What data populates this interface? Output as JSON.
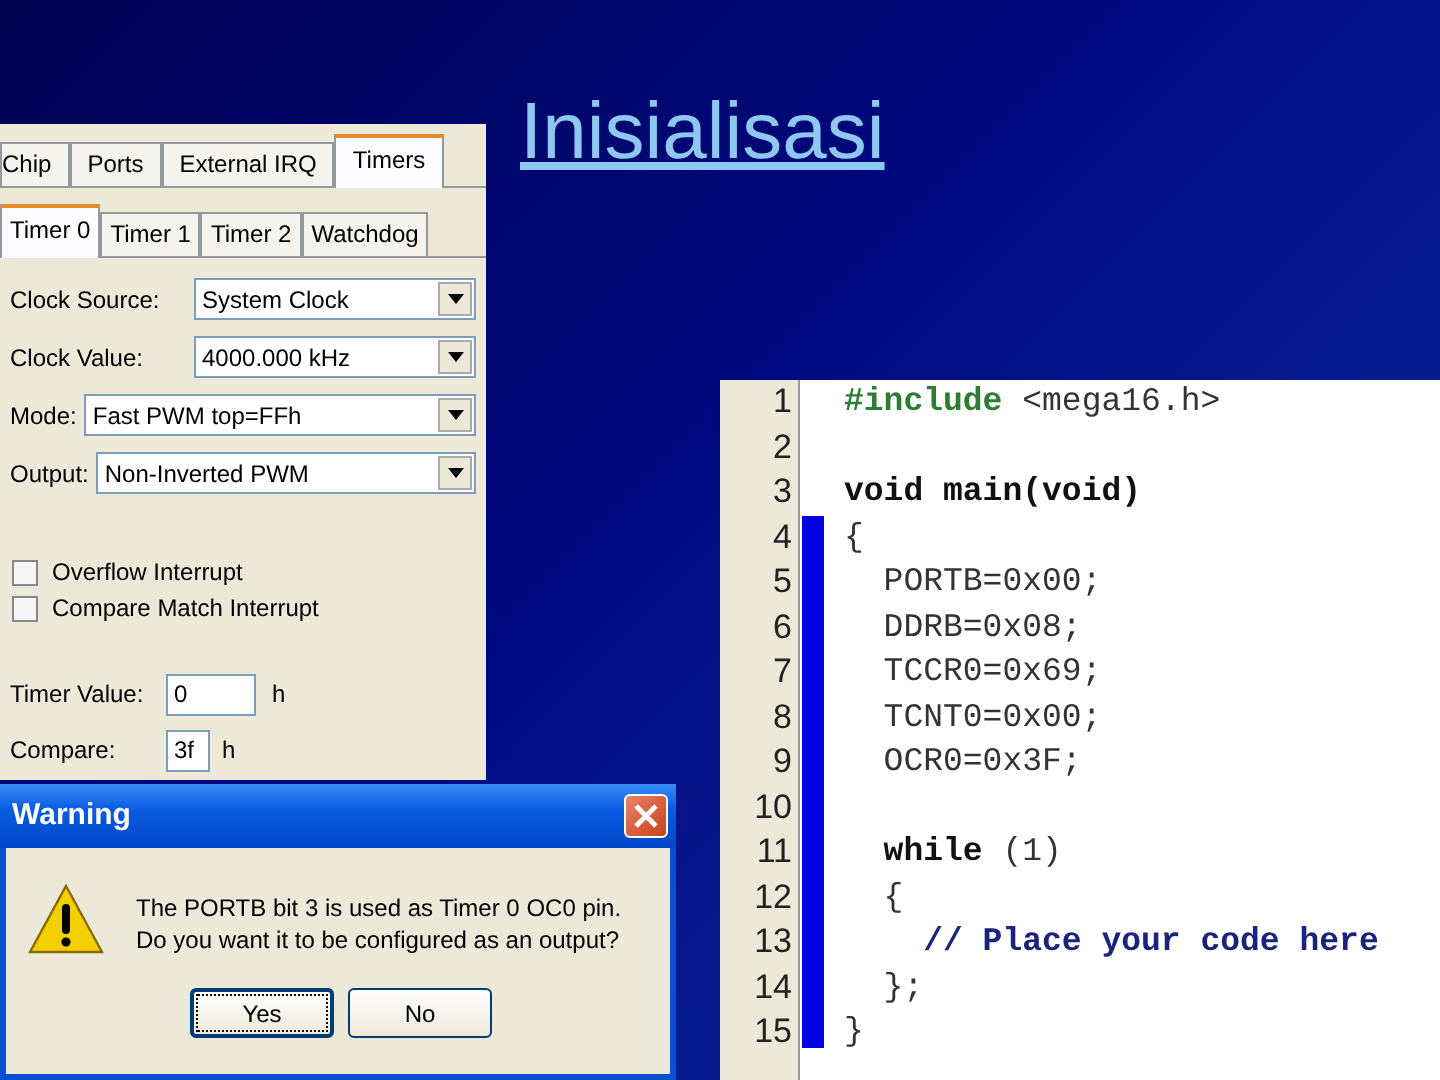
{
  "slide": {
    "title": "Inisialisasi"
  },
  "timer_settings": {
    "tabs": [
      {
        "label": "Chip",
        "selected": false
      },
      {
        "label": "Ports",
        "selected": false
      },
      {
        "label": "External IRQ",
        "selected": false
      },
      {
        "label": "Timers",
        "selected": true
      }
    ],
    "subtabs": [
      {
        "label": "Timer 0",
        "selected": true
      },
      {
        "label": "Timer 1",
        "selected": false
      },
      {
        "label": "Timer 2",
        "selected": false
      },
      {
        "label": "Watchdog",
        "selected": false
      }
    ],
    "fields": [
      {
        "label": "Clock Source:",
        "value": "System Clock"
      },
      {
        "label": "Clock Value:",
        "value": "4000.000 kHz"
      },
      {
        "label": "Mode:",
        "value": "Fast PWM top=FFh"
      },
      {
        "label": "Output:",
        "value": "Non-Inverted PWM"
      }
    ],
    "checkboxes": [
      {
        "label": "Overflow Interrupt",
        "checked": false
      },
      {
        "label": "Compare Match Interrupt",
        "checked": false
      }
    ],
    "value_fields": [
      {
        "label": "Timer Value:",
        "value": "0",
        "unit": "h"
      },
      {
        "label": "Compare:",
        "value": "3f",
        "unit": "h"
      }
    ]
  },
  "warning_dialog": {
    "title": "Warning",
    "message": [
      "The PORTB bit 3 is used as Timer 0 OC0 pin.",
      "Do you want it to be configured as an output?"
    ],
    "buttons": [
      {
        "label": "Yes",
        "focused": true
      },
      {
        "label": "No",
        "focused": false
      }
    ]
  },
  "code_editor": {
    "lines": [
      {
        "number": "1",
        "tokens": [
          {
            "text": "#include",
            "kind": "directive"
          },
          {
            "text": " <mega16.h>",
            "kind": "plain"
          }
        ]
      },
      {
        "number": "2"
      },
      {
        "number": "3",
        "tokens": [
          {
            "text": "void main(void)",
            "kind": "keyword"
          }
        ]
      },
      {
        "number": "4",
        "tokens": [
          {
            "text": "{",
            "kind": "plain"
          }
        ]
      },
      {
        "number": "5",
        "tokens": [
          {
            "text": "  PORTB=0x00;",
            "kind": "plain"
          }
        ]
      },
      {
        "number": "6",
        "tokens": [
          {
            "text": "  DDRB=0x08;",
            "kind": "plain"
          }
        ]
      },
      {
        "number": "7",
        "tokens": [
          {
            "text": "  TCCR0=0x69;",
            "kind": "plain"
          }
        ]
      },
      {
        "number": "8",
        "tokens": [
          {
            "text": "  TCNT0=0x00;",
            "kind": "plain"
          }
        ]
      },
      {
        "number": "9",
        "tokens": [
          {
            "text": "  OCR0=0x3F;",
            "kind": "plain"
          }
        ]
      },
      {
        "number": "10"
      },
      {
        "number": "11",
        "tokens": [
          {
            "text": "  while",
            "kind": "keyword"
          },
          {
            "text": " (1)",
            "kind": "plain"
          }
        ]
      },
      {
        "number": "12",
        "tokens": [
          {
            "text": "  {",
            "kind": "plain"
          }
        ]
      },
      {
        "number": "13",
        "tokens": [
          {
            "text": "    // Place your code here",
            "kind": "comment"
          }
        ]
      },
      {
        "number": "14",
        "tokens": [
          {
            "text": "  };",
            "kind": "plain"
          }
        ]
      },
      {
        "number": "15",
        "tokens": [
          {
            "text": "}",
            "kind": "plain"
          }
        ]
      }
    ]
  }
}
